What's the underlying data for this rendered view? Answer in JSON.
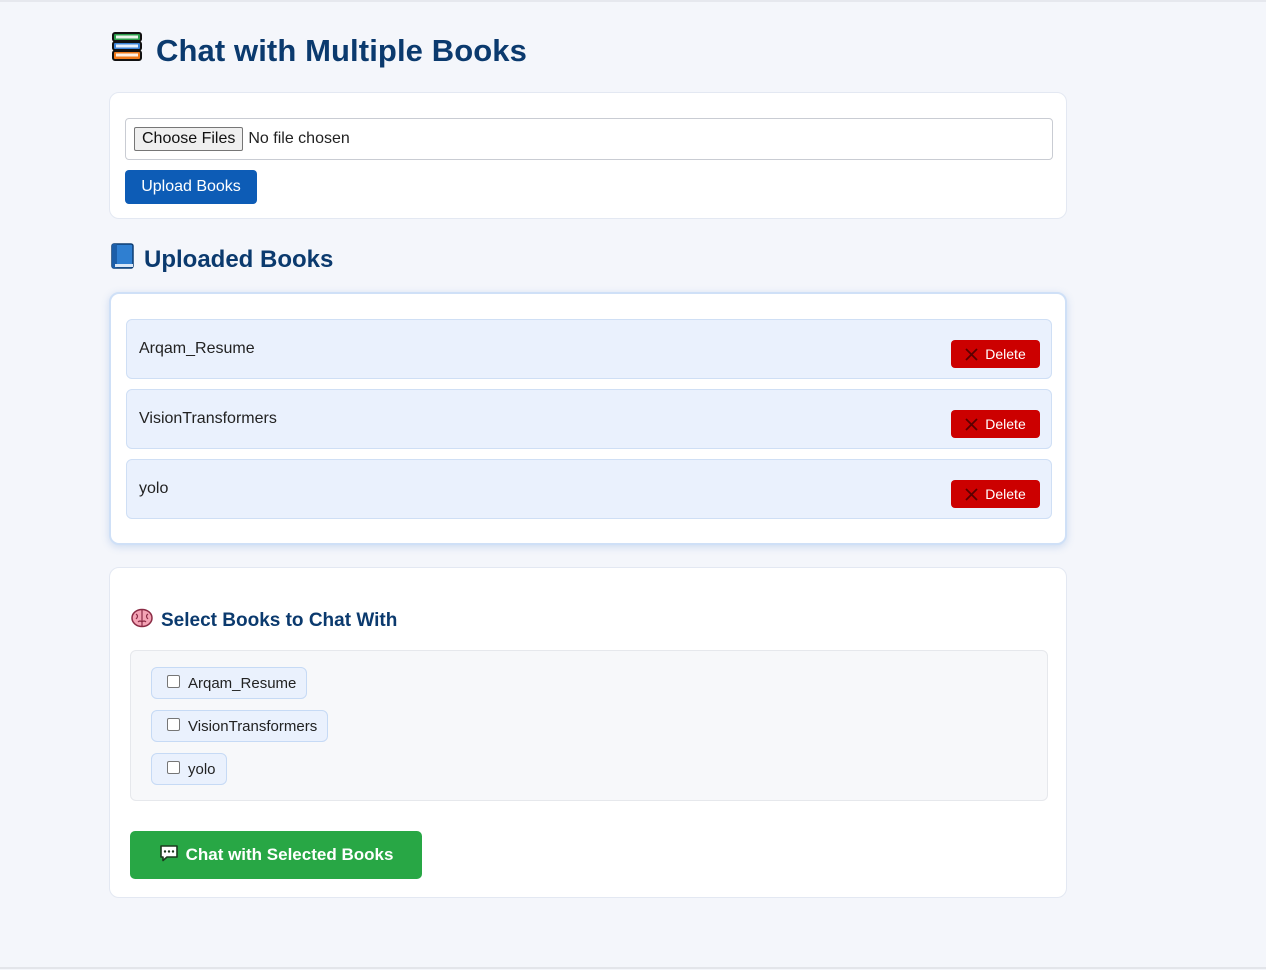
{
  "header": {
    "title": "Chat with Multiple Books",
    "icon": "books-icon"
  },
  "upload": {
    "choose_label": "Choose Files",
    "file_status": "No file chosen",
    "upload_button": "Upload Books"
  },
  "uploaded_section": {
    "title": "Uploaded Books",
    "icon": "blue-book-icon",
    "books": [
      {
        "name": "Arqam_Resume",
        "delete_label": "Delete"
      },
      {
        "name": "VisionTransformers",
        "delete_label": "Delete"
      },
      {
        "name": "yolo",
        "delete_label": "Delete"
      }
    ]
  },
  "select_section": {
    "title": "Select Books to Chat With",
    "icon": "brain-icon",
    "options": [
      {
        "label": "Arqam_Resume",
        "checked": false
      },
      {
        "label": "VisionTransformers",
        "checked": false
      },
      {
        "label": "yolo",
        "checked": false
      }
    ],
    "chat_button": "Chat with Selected Books",
    "chat_icon": "speech-bubble-icon"
  },
  "colors": {
    "heading": "#0b3a6e",
    "primary_button": "#0d5cb6",
    "delete_button": "#cc0000",
    "chat_button": "#28a745"
  }
}
